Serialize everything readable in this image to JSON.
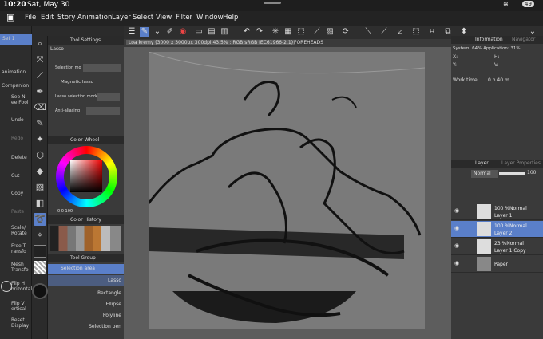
{
  "status": {
    "time": "10:20",
    "date": "Sat, May 30",
    "battery": "49"
  },
  "menu": [
    "File",
    "Edit",
    "Story",
    "Animation",
    "Layer",
    "Select",
    "View",
    "Filter",
    "Window",
    "Help"
  ],
  "commands": [
    {
      "label": "Set 1"
    },
    {
      "label": "animation"
    },
    {
      "label": "Companion"
    },
    {
      "label": "See N\nee Fool"
    },
    {
      "label": "Undo"
    },
    {
      "label": "Redo"
    },
    {
      "label": "Delete"
    },
    {
      "label": "Cut"
    },
    {
      "label": "Copy"
    },
    {
      "label": "Paste"
    },
    {
      "label": "Scale/\nRotate"
    },
    {
      "label": "Free T\nransfo"
    },
    {
      "label": "Mesh\nTransfo"
    },
    {
      "label": "Flip H\norizontal"
    },
    {
      "label": "Flip V\nertical"
    },
    {
      "label": "Reset\nDisplay"
    }
  ],
  "tool_settings": {
    "title": "Tool Settings",
    "subtool": "Lasso",
    "selection_mode_label": "Selection mo",
    "magnetic": "Magnetic lasso",
    "lasso_mode_label": "Lasso selection mode",
    "aa_label": "Anti-aliasing"
  },
  "color_wheel": {
    "title": "Color Wheel",
    "values": "0  0  100"
  },
  "color_history": {
    "title": "Color History"
  },
  "tool_group": {
    "title": "Tool Group",
    "group": "Selection area",
    "items": [
      "Lasso",
      "Rectangle",
      "Ellipse",
      "Polyline",
      "Selection pen"
    ]
  },
  "canvas": {
    "tab": "Loa kremy (3000 x 3000px 300dpi 43.5% : RGB sRGB IEC61966-2.1)",
    "tab2": "FOREHEADS"
  },
  "info": {
    "title": "Information",
    "nav": "Navigator",
    "system": "System: 64% Application: 31%",
    "x": "X:",
    "y": "Y:",
    "h": "H:",
    "v": "V:",
    "worktime_label": "Work time:",
    "worktime": "0 h 40 m"
  },
  "layer_panel": {
    "title": "Layer",
    "title2": "Layer Properties",
    "blend": "Normal",
    "opacity": "100",
    "layers": [
      {
        "opacity": "100 %Normal",
        "name": "Layer 1"
      },
      {
        "opacity": "100 %Normal",
        "name": "Layer 2"
      },
      {
        "opacity": "23 %Normal",
        "name": "Layer 1 Copy"
      },
      {
        "opacity": "",
        "name": "Paper"
      }
    ]
  },
  "colors": {
    "accent": "#5a7fc9",
    "bg": "#2b2b2b",
    "panel": "#3a3a3a"
  }
}
